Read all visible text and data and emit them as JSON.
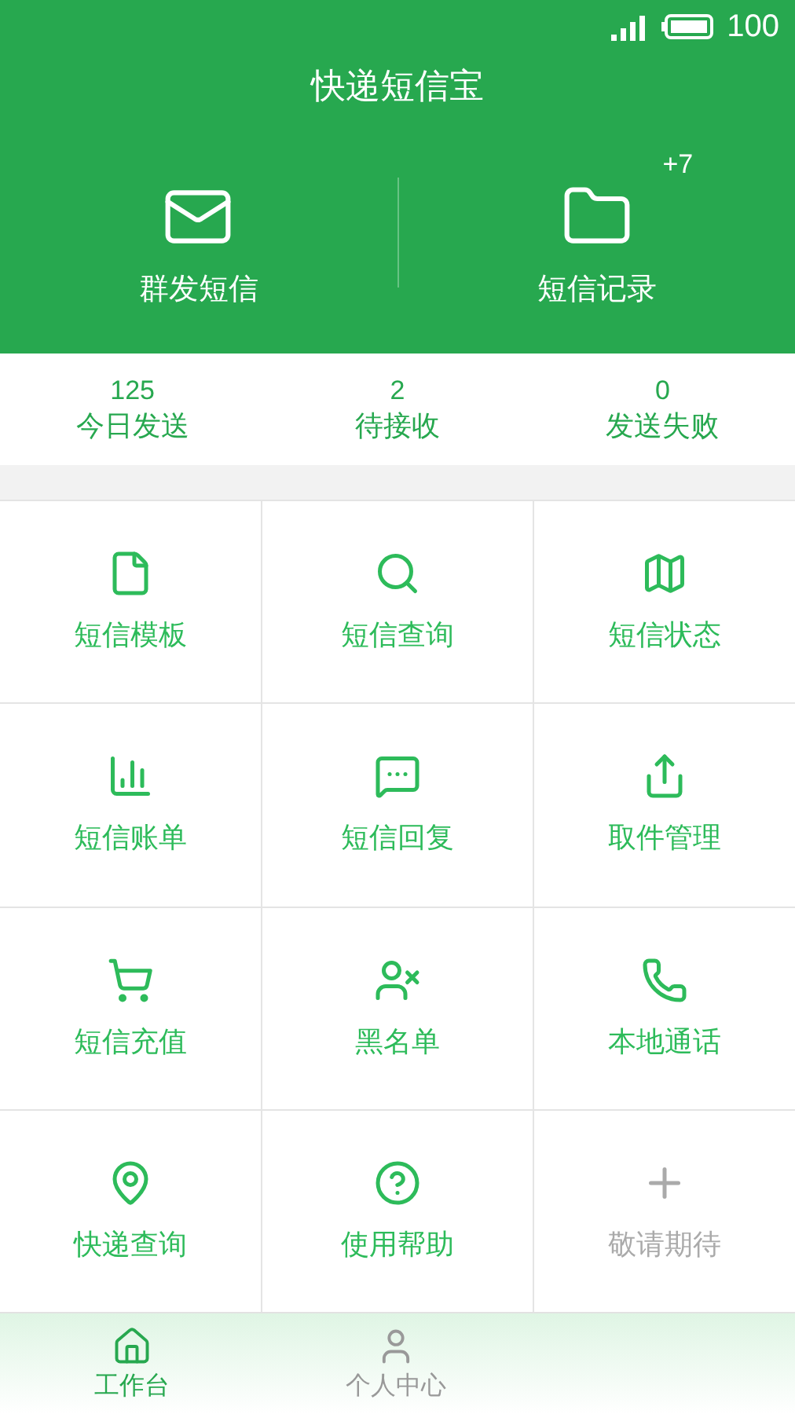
{
  "status_bar": {
    "battery": "100"
  },
  "header": {
    "title": "快递短信宝"
  },
  "actions": [
    {
      "label": "群发短信"
    },
    {
      "label": "短信记录",
      "badge": "+7"
    }
  ],
  "stats": [
    {
      "value": "125",
      "label": "今日发送"
    },
    {
      "value": "2",
      "label": "待接收"
    },
    {
      "value": "0",
      "label": "发送失败"
    }
  ],
  "grid": [
    {
      "label": "短信模板",
      "disabled": false
    },
    {
      "label": "短信查询",
      "disabled": false
    },
    {
      "label": "短信状态",
      "disabled": false
    },
    {
      "label": "短信账单",
      "disabled": false
    },
    {
      "label": "短信回复",
      "disabled": false
    },
    {
      "label": "取件管理",
      "disabled": false
    },
    {
      "label": "短信充值",
      "disabled": false
    },
    {
      "label": "黑名单",
      "disabled": false
    },
    {
      "label": "本地通话",
      "disabled": false
    },
    {
      "label": "快递查询",
      "disabled": false
    },
    {
      "label": "使用帮助",
      "disabled": false
    },
    {
      "label": "敬请期待",
      "disabled": true
    }
  ],
  "tabs": [
    {
      "label": "工作台",
      "selected": true
    },
    {
      "label": "个人中心",
      "selected": false
    }
  ]
}
